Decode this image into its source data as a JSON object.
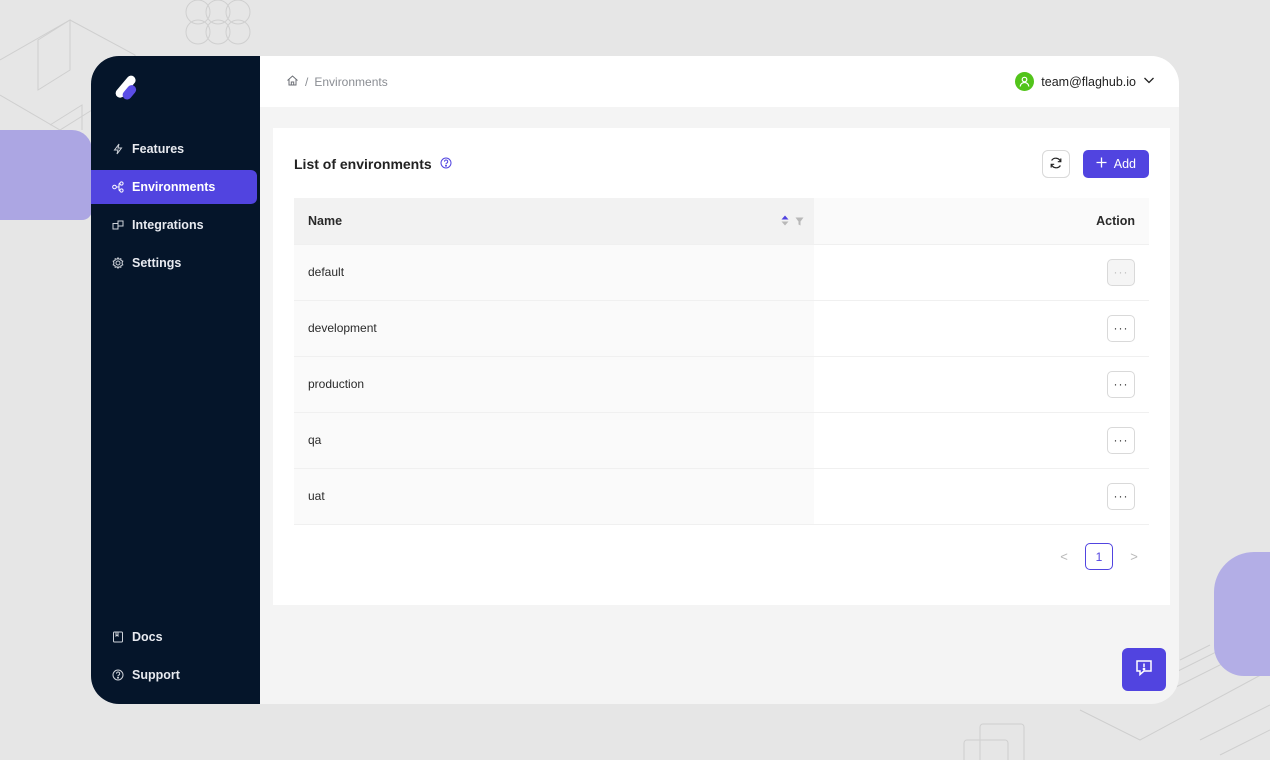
{
  "brand": {
    "logo_icon": "flaghub-logo-icon"
  },
  "sidebar": {
    "items": [
      {
        "label": "Features",
        "icon": "bolt-icon"
      },
      {
        "label": "Environments",
        "icon": "environments-icon",
        "active": true
      },
      {
        "label": "Integrations",
        "icon": "integrations-icon"
      },
      {
        "label": "Settings",
        "icon": "gear-icon"
      }
    ],
    "bottom_items": [
      {
        "label": "Docs",
        "icon": "book-icon"
      },
      {
        "label": "Support",
        "icon": "help-circle-icon"
      }
    ]
  },
  "header": {
    "breadcrumb_current": "Environments",
    "breadcrumb_separator": "/",
    "user_email": "team@flaghub.io"
  },
  "panel": {
    "title": "List of environments",
    "add_label": "Add"
  },
  "table": {
    "columns": [
      "Name",
      "Action"
    ],
    "rows": [
      {
        "name": "default",
        "action_disabled": true
      },
      {
        "name": "development",
        "action_disabled": false
      },
      {
        "name": "production",
        "action_disabled": false
      },
      {
        "name": "qa",
        "action_disabled": false
      },
      {
        "name": "uat",
        "action_disabled": false
      }
    ],
    "more_label": "···"
  },
  "pagination": {
    "current_page": "1",
    "prev": "<",
    "next": ">"
  },
  "colors": {
    "accent": "#5144e0",
    "sidebar_bg": "#05152a",
    "avatar": "#52c41a"
  }
}
